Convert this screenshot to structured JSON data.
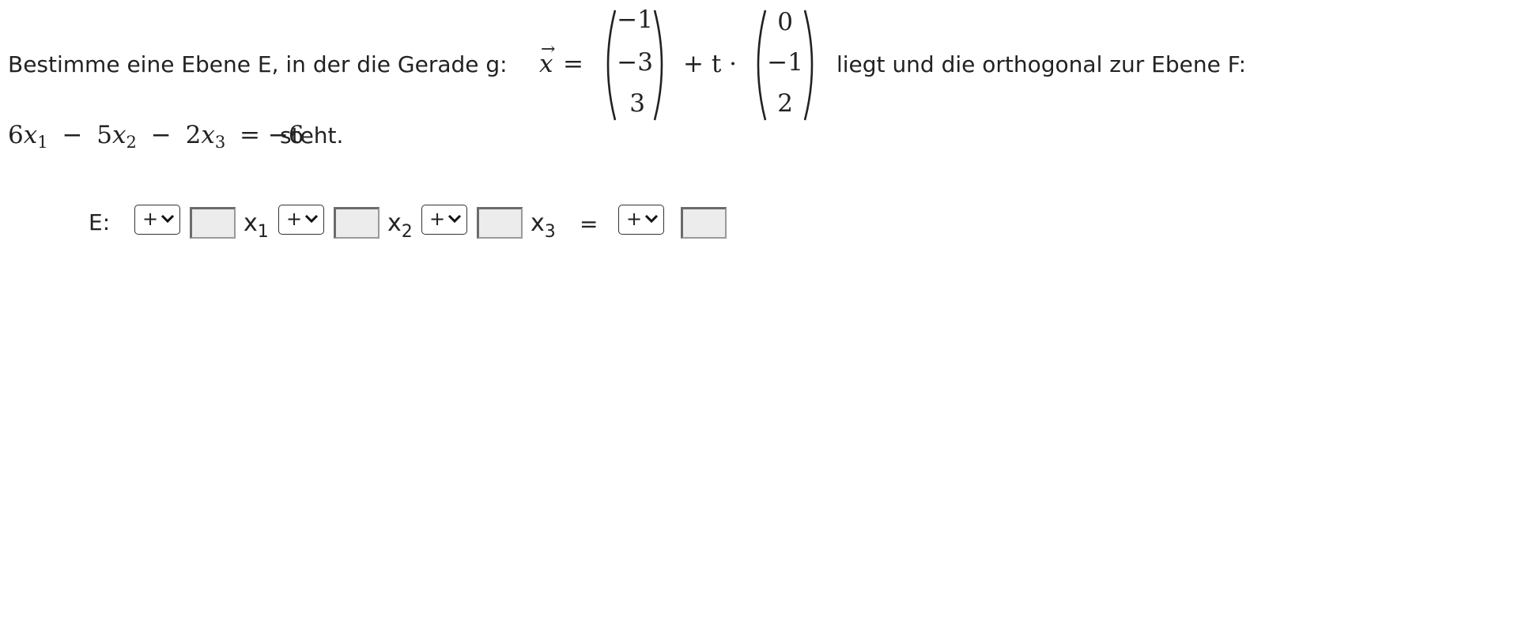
{
  "task": {
    "intro_text": "Bestimme eine Ebene E, in der die Gerade g:",
    "vector_var": "x",
    "vector_arrow": "→",
    "equals": "=",
    "support_vector": [
      "−1",
      "−3",
      "3"
    ],
    "plus_t_dot": "+ t ·",
    "direction_vector": [
      "0",
      "−1",
      "2"
    ],
    "middle_text": "liegt und die orthogonal zur Ebene F:",
    "plane_F": {
      "coef1": "6",
      "var": "x",
      "sub1": "1",
      "op1": "−",
      "coef2": "5",
      "sub2": "2",
      "op2": "−",
      "coef3": "2",
      "sub3": "3",
      "rhs": "= −6"
    },
    "end_text": "steht."
  },
  "answer": {
    "label": "E:",
    "var_x": "x",
    "sub1": "1",
    "sub2": "2",
    "sub3": "3",
    "equals": "=",
    "sign_selects": [
      "+",
      "+",
      "+",
      "+"
    ],
    "inputs": [
      "",
      "",
      "",
      ""
    ]
  }
}
